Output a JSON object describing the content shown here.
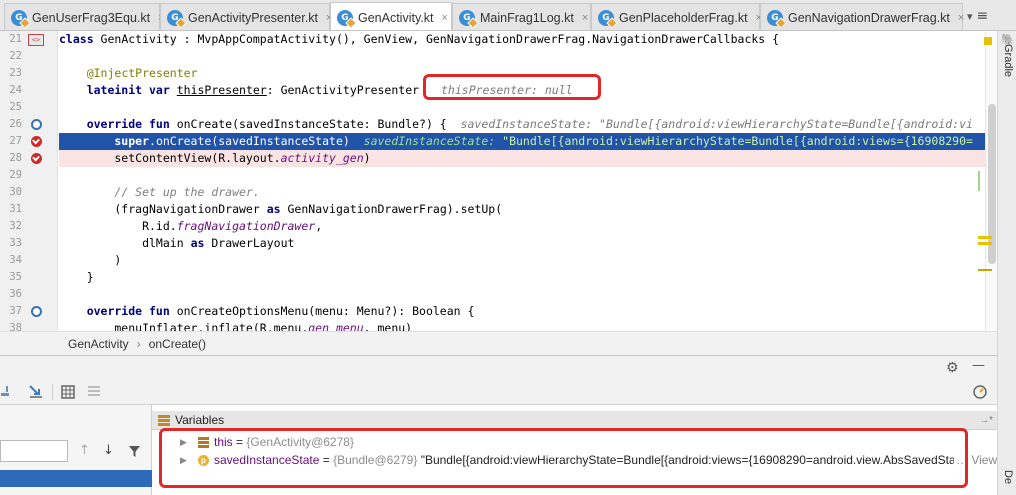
{
  "tabs": [
    {
      "label": "GenUserFrag3Equ.kt",
      "close": "×",
      "icon_glyph": "G"
    },
    {
      "label": "GenActivityPresenter.kt",
      "close": "×",
      "icon_glyph": "G"
    },
    {
      "label": "GenActivity.kt",
      "close": "×",
      "icon_glyph": "G"
    },
    {
      "label": "MainFrag1Log.kt",
      "close": "×",
      "icon_glyph": "G"
    },
    {
      "label": "GenPlaceholderFrag.kt",
      "close": "×",
      "icon_glyph": "G"
    },
    {
      "label": "GenNavigationDrawerFrag.kt",
      "close": "×",
      "icon_glyph": "G"
    }
  ],
  "tab_overflow": "▾",
  "tab_overflow_menu": "≡",
  "line_numbers": [
    "21",
    "22",
    "23",
    "24",
    "25",
    "26",
    "27",
    "28",
    "29",
    "30",
    "31",
    "32",
    "33",
    "34",
    "35",
    "36",
    "37",
    "38"
  ],
  "code": {
    "l21": {
      "a": "class",
      "b": " GenActivity : MvpAppCompatActivity(), GenView, GenNavigationDrawerFrag.NavigationDrawerCallbacks {"
    },
    "l23": {
      "a": "    ",
      "b": "@InjectPresenter"
    },
    "l24": {
      "a": "    lateinit var",
      "b": " ",
      "c": "thisPresenter",
      "d": ": GenActivityPresente",
      "e": "r",
      "f": "thisPresenter: null"
    },
    "l26": {
      "a": "    override fun",
      "b": " onCreate(savedInstanceState: Bundle?) {  ",
      "c": "savedInstanceState: \"Bundle[{android:viewHierarchyState=Bundle[{android:vi"
    },
    "l27": {
      "a": "        super",
      "b": ".onCreate(savedInstanceState)  ",
      "c": "savedInstanceState: ",
      "d": "\"Bundle[{android:viewHierarchyState=Bundle[{android:views={16908290="
    },
    "l28": {
      "a": "        setContentView(R.layout.",
      "b": "activity_gen",
      "c": ")"
    },
    "l30": {
      "a": "        ",
      "b": "// Set up the drawer."
    },
    "l31": {
      "a": "        (fragNavigationDrawer ",
      "b": "as",
      "c": " GenNavigationDrawerFrag).setUp("
    },
    "l32": {
      "a": "            R.id.",
      "b": "fragNavigationDrawer",
      "c": ","
    },
    "l33": {
      "a": "            dlMain ",
      "b": "as",
      "c": " DrawerLayout"
    },
    "l34": {
      "a": "        )"
    },
    "l35": {
      "a": "    }"
    },
    "l37": {
      "a": "    override fun",
      "b": " onCreateOptionsMenu(menu: Menu?): Boolean {"
    },
    "l38": {
      "a": "        menuInflater.inflate(R.menu.",
      "b": "gen_menu",
      "c": ", menu)"
    }
  },
  "gutter_icons": {
    "l21": "<>",
    "l26": "override",
    "l27": "breakpoint",
    "l28": "breakpoint",
    "l37": "override"
  },
  "side_tools": {
    "gradle": "Gradle",
    "device": "De"
  },
  "breadcrumb": {
    "class": "GenActivity",
    "sep": "›",
    "method": "onCreate()"
  },
  "panel": {
    "settings_icon": "⚙",
    "minimize_icon": "—"
  },
  "variables": {
    "header": "Variables",
    "header_pin": "→*",
    "rows": [
      {
        "name": "this",
        "eq": " = ",
        "type": "{GenActivity@6278}",
        "value": "",
        "link": ""
      },
      {
        "name": "savedInstanceState",
        "eq": " = ",
        "type": "{Bundle@6279}",
        "value": " \"Bundle[{android:viewHierarchyState=Bundle[{android:views={16908290=android.view.AbsSavedState$",
        "link": "… View"
      }
    ]
  },
  "colors": {
    "tab_icon": "#3b8ed6",
    "execution_line": "#2154a8",
    "breakpoint_line": "#fae3e3",
    "breakpoint": "#cc2828",
    "highlight_box": "#e02828"
  }
}
